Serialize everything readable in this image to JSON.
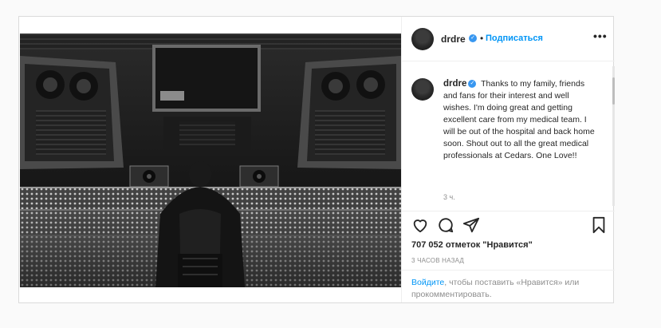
{
  "post": {
    "username": "drdre",
    "verified_mark": "✓",
    "separator": "•",
    "follow_label": "Подписаться",
    "more_label": "•••",
    "caption": "Thanks to my family, friends and fans for their interest and well wishes. I'm doing great and getting excellent care from my medical team. I will be out of the hospital and back home soon. Shout out to all the great medical professionals at Cedars. One Love!!",
    "caption_age": "3 ч.",
    "load_more_glyph": "+",
    "likes": "707 052 отметок \"Нравится\"",
    "timestamp": "3 ЧАСОВ НАЗАД",
    "login_link": "Войдите",
    "login_text": ", чтобы поставить «Нравится» или прокомментировать.",
    "image_icon": "studio-photo",
    "icons": {
      "like": "heart-icon",
      "comment": "comment-icon",
      "share": "share-icon",
      "save": "bookmark-icon"
    },
    "colors": {
      "accent": "#0095f6",
      "verified": "#3897f0",
      "muted": "#8e8e8e"
    }
  }
}
